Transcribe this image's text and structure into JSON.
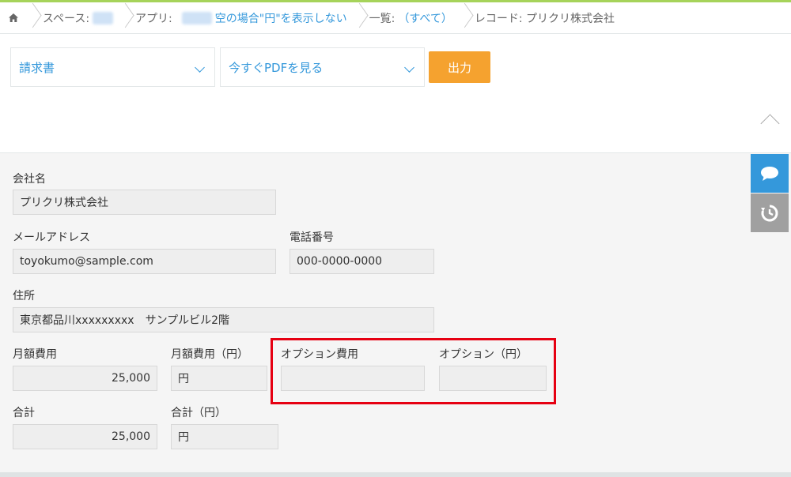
{
  "breadcrumb": {
    "space_label": "スペース:",
    "space_value": "████",
    "app_label": "アプリ:",
    "app_name_blurred": "█████",
    "app_name": "空の場合\"円\"を表示しない",
    "list_label": "一覧:",
    "list_value": "（すべて）",
    "record_label": "レコード: プリクリ株式会社"
  },
  "toolbar": {
    "template_select": "請求書",
    "action_select": "今すぐPDFを見る",
    "output_button": "出力"
  },
  "form": {
    "company_label": "会社名",
    "company_value": "プリクリ株式会社",
    "email_label": "メールアドレス",
    "email_value": "toyokumo@sample.com",
    "phone_label": "電話番号",
    "phone_value": "000-0000-0000",
    "address_label": "住所",
    "address_value": "東京都品川xxxxxxxxx　サンプルビル2階",
    "monthly_label": "月額費用",
    "monthly_value": "25,000",
    "monthly_yen_label": "月額費用（円）",
    "monthly_yen_value": "円",
    "option_label": "オプション費用",
    "option_value": "",
    "option_yen_label": "オプション（円）",
    "option_yen_value": "",
    "total_label": "合計",
    "total_value": "25,000",
    "total_yen_label": "合計（円）",
    "total_yen_value": "円"
  },
  "icons": {
    "home": "home-icon",
    "comment": "comment-icon",
    "history": "history-icon",
    "collapse": "chevron-up-icon"
  },
  "colors": {
    "accent_blue": "#3498db",
    "output_orange": "#f5a22f",
    "highlight_red": "#e60012"
  }
}
